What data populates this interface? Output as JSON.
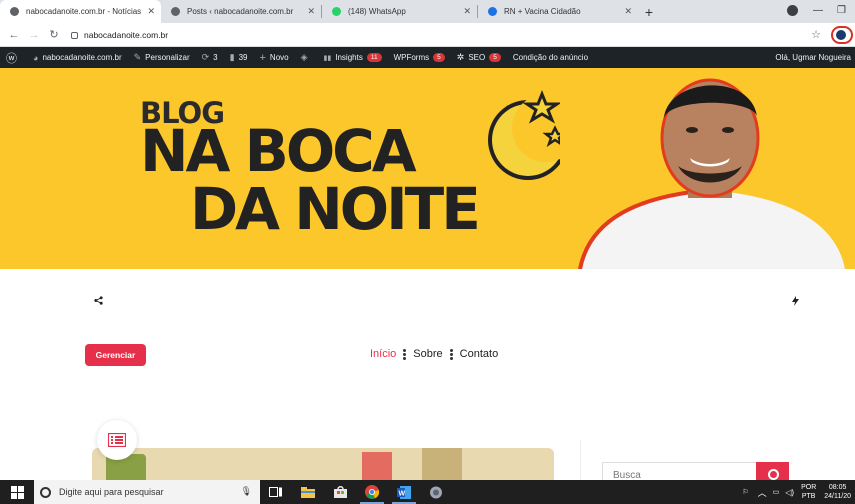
{
  "browser": {
    "tabs": [
      {
        "title": "nabocadanoite.com.br - Notícias",
        "favicon_color": "#5f6368",
        "active": true
      },
      {
        "title": "Posts ‹ nabocadanoite.com.br",
        "favicon_color": "#5f6368",
        "active": false
      },
      {
        "title": "(148) WhatsApp",
        "favicon_color": "#25d366",
        "active": false
      },
      {
        "title": "RN + Vacina Cidadão",
        "favicon_color": "#1a73e8",
        "active": false
      }
    ],
    "new_tab_label": "+",
    "url": "nabocadanoite.com.br"
  },
  "wp_admin_bar": {
    "items": [
      {
        "icon": "wordpress-icon",
        "glyph": "ⓦ",
        "label": ""
      },
      {
        "icon": "dashboard-icon",
        "glyph": "◕",
        "label": "nabocadanoite.com.br"
      },
      {
        "icon": "brush-icon",
        "glyph": "✎",
        "label": "Personalizar"
      },
      {
        "icon": "updates-icon",
        "glyph": "⟳",
        "label": "3"
      },
      {
        "icon": "comments-icon",
        "glyph": "▮",
        "label": "39"
      },
      {
        "icon": "plus-icon",
        "glyph": "+",
        "label": "Novo"
      },
      {
        "icon": "diamond-icon",
        "glyph": "◈",
        "label": ""
      },
      {
        "icon": "insights-icon",
        "glyph": "▮▮",
        "label": "Insights",
        "badge": "11"
      },
      {
        "icon": "",
        "glyph": "",
        "label": "WPForms",
        "badge": "5"
      },
      {
        "icon": "seo-icon",
        "glyph": "✲",
        "label": "SEO",
        "badge": "5"
      },
      {
        "icon": "",
        "glyph": "",
        "label": "Condição do anúncio"
      }
    ],
    "greeting": "Olá, Ugmar Nogueira"
  },
  "banner": {
    "line1": "BLOG",
    "line2": "NA BOCA",
    "line3": "DA NOITE"
  },
  "header": {
    "manage_button": "Gerenciar",
    "nav": [
      {
        "label": "Início",
        "active": true
      },
      {
        "label": "Sobre",
        "active": false
      },
      {
        "label": "Contato",
        "active": false
      }
    ]
  },
  "sidebar": {
    "search_placeholder": "Busca"
  },
  "taskbar": {
    "search_placeholder": "Digite aqui para pesquisar",
    "language_top": "POR",
    "language_bottom": "PTB",
    "time": "08:05",
    "date": "24/11/20"
  },
  "colors": {
    "accent": "#e6304b",
    "banner_yellow": "#fbc72a",
    "wp_bar": "#1d2327"
  }
}
